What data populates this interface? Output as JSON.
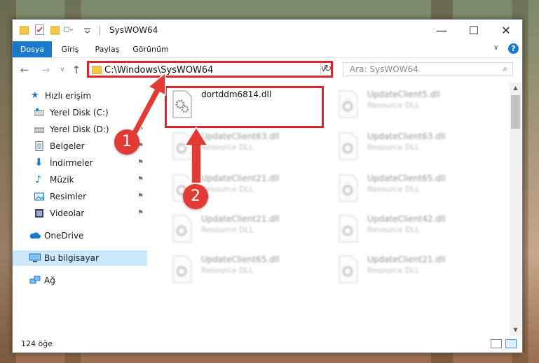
{
  "window": {
    "title": "SysWOW64"
  },
  "ribbon": {
    "tabs": [
      "Dosya",
      "Giriş",
      "Paylaş",
      "Görünüm"
    ]
  },
  "address": {
    "path": "C:\\Windows\\SysWOW64"
  },
  "search": {
    "placeholder": "Ara: SysWOW64"
  },
  "nav": {
    "quick_access": "Hızlı erişim",
    "items": [
      "Yerel Disk (C:)",
      "Yerel Disk (D:)",
      "Belgeler",
      "İndirmeler",
      "Müzik",
      "Resimler",
      "Videolar"
    ],
    "onedrive": "OneDrive",
    "this_pc": "Bu bilgisayar",
    "network": "Ağ"
  },
  "files": {
    "main": {
      "name": "dortddm6814.dll"
    },
    "col1": [
      {
        "name": "UpdateClient63.dll",
        "type": "Resource DLL"
      },
      {
        "name": "UpdateClient21.dll",
        "type": "Resource DLL"
      },
      {
        "name": "UpdateClient21.dll",
        "type": "Resource DLL"
      },
      {
        "name": "UpdateClient65.dll",
        "type": "Resource DLL"
      }
    ],
    "col2": [
      {
        "name": "UpdateClient5.dll",
        "type": "Resource DLL"
      },
      {
        "name": "UpdateClient63.dll",
        "type": "Resource DLL"
      },
      {
        "name": "UpdateClient65.dll",
        "type": "Resource DLL"
      },
      {
        "name": "UpdateClient42.dll",
        "type": "Resource DLL"
      },
      {
        "name": "UpdateClient21.dll",
        "type": "Resource DLL"
      }
    ]
  },
  "status": {
    "count": "124 öğe"
  },
  "callouts": [
    "1",
    "2"
  ],
  "colors": {
    "accent": "#1979ca",
    "highlight": "#d9262e",
    "selected": "#cce8ff"
  }
}
